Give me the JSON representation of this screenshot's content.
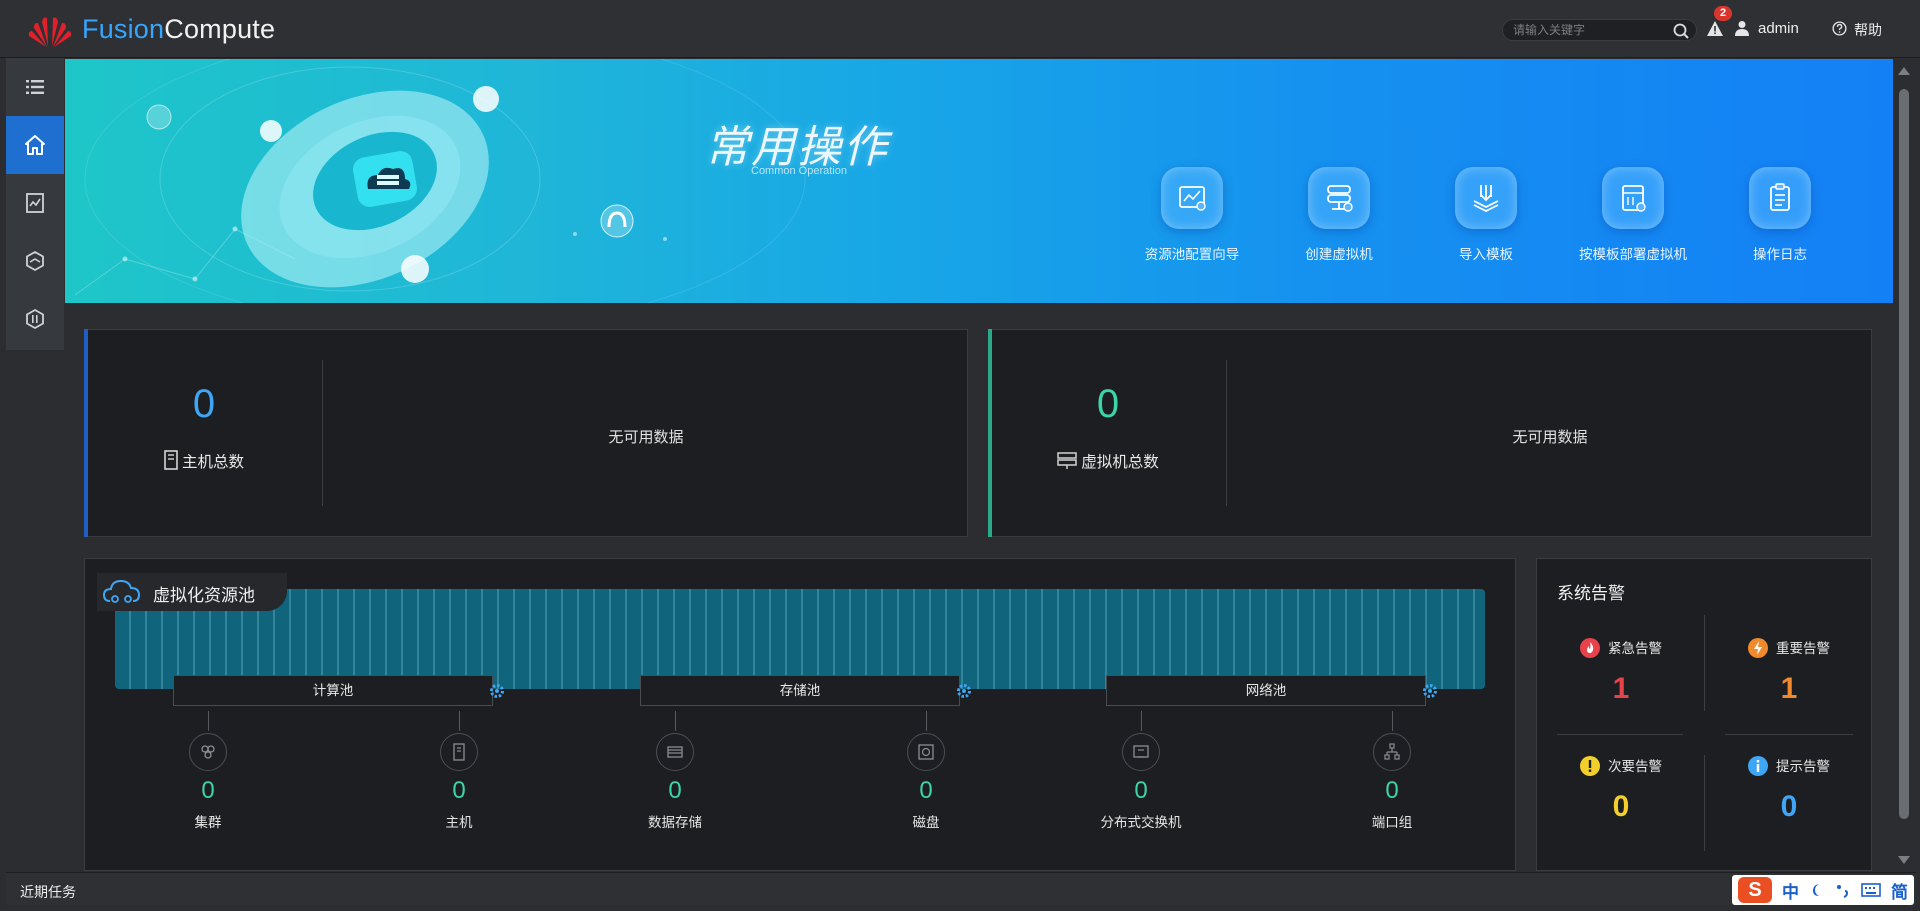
{
  "app": {
    "brand_part1": "Fusion",
    "brand_part2": "Compute"
  },
  "header": {
    "search_placeholder": "请输入关键字",
    "alarm_badge": "2",
    "user": "admin",
    "help": "帮助"
  },
  "nav": {
    "icons": [
      "list-icon",
      "home-icon",
      "monitor-icon",
      "resource-icon",
      "system-icon"
    ],
    "active": "home-icon"
  },
  "banner": {
    "title": "常用操作",
    "subtitle": "Common Operation",
    "operations": [
      {
        "label": "资源池配置向导",
        "icon": "config-wizard-icon"
      },
      {
        "label": "创建虚拟机",
        "icon": "create-vm-icon"
      },
      {
        "label": "导入模板",
        "icon": "import-template-icon"
      },
      {
        "label": "按模板部署虚拟机",
        "icon": "deploy-template-icon"
      },
      {
        "label": "操作日志",
        "icon": "operation-log-icon"
      }
    ]
  },
  "stats": {
    "hosts": {
      "value": "0",
      "label": "主机总数",
      "empty": "无可用数据",
      "color": "#3fa6f5"
    },
    "vms": {
      "value": "0",
      "label": "虚拟机总数",
      "empty": "无可用数据",
      "color": "#3bd6a6"
    }
  },
  "pool": {
    "title": "虚拟化资源池",
    "groups": [
      "计算池",
      "存储池",
      "网络池"
    ],
    "resources": [
      {
        "label": "集群",
        "value": "0",
        "icon": "cluster-icon"
      },
      {
        "label": "主机",
        "value": "0",
        "icon": "host-icon"
      },
      {
        "label": "数据存储",
        "value": "0",
        "icon": "datastore-icon"
      },
      {
        "label": "磁盘",
        "value": "0",
        "icon": "disk-icon"
      },
      {
        "label": "分布式交换机",
        "value": "0",
        "icon": "switch-icon"
      },
      {
        "label": "端口组",
        "value": "0",
        "icon": "port-group-icon"
      }
    ]
  },
  "alarms": {
    "title": "系统告警",
    "items": [
      {
        "label": "紧急告警",
        "value": "1",
        "color": "#e8434b"
      },
      {
        "label": "重要告警",
        "value": "1",
        "color": "#f08a2c"
      },
      {
        "label": "次要告警",
        "value": "0",
        "color": "#f2cf2a"
      },
      {
        "label": "提示告警",
        "value": "0",
        "color": "#3fa6f5"
      }
    ]
  },
  "footer": {
    "recent_tasks": "近期任务",
    "ime_items": [
      "中",
      "简"
    ]
  }
}
